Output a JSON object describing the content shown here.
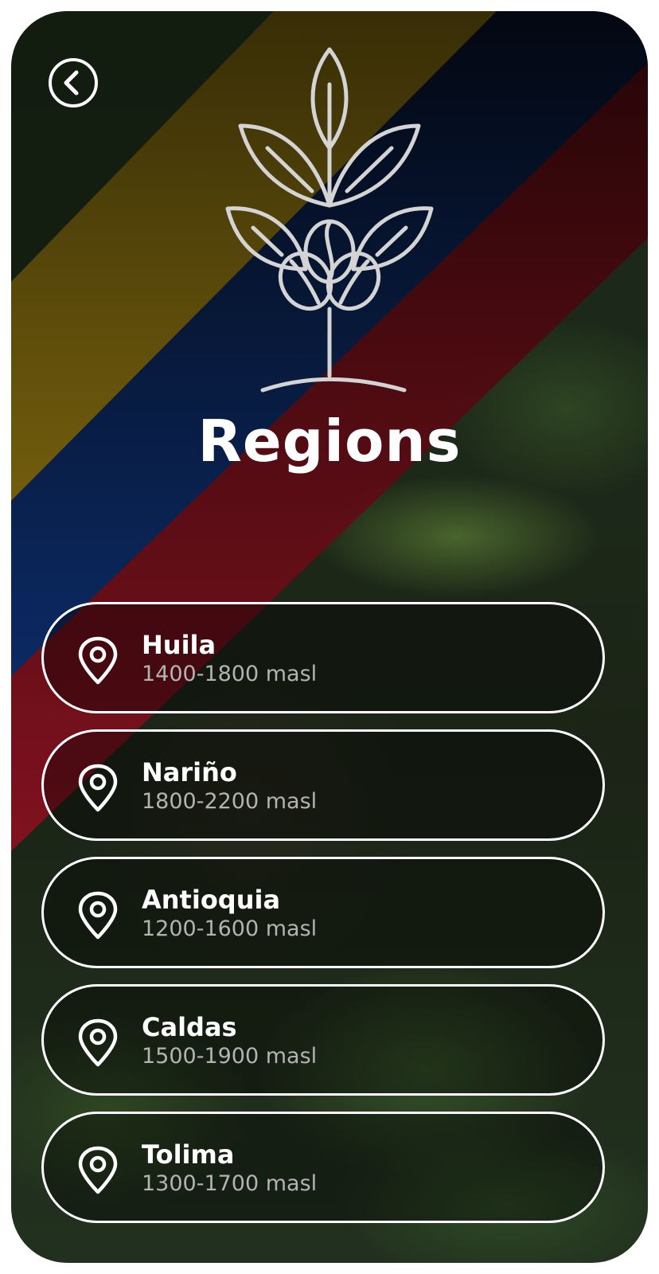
{
  "header": {
    "title": "Regions",
    "back_icon": "chevron-left-icon",
    "logo_icon": "coffee-plant-icon"
  },
  "flag_colors": {
    "yellow": "#5a4708",
    "blue": "#06173d",
    "red": "#4a0810"
  },
  "regions": [
    {
      "name": "Huila",
      "altitude": "1400-1800 masl",
      "icon": "location-pin-icon"
    },
    {
      "name": "Nariño",
      "altitude": "1800-2200 masl",
      "icon": "location-pin-icon"
    },
    {
      "name": "Antioquia",
      "altitude": "1200-1600 masl",
      "icon": "location-pin-icon"
    },
    {
      "name": "Caldas",
      "altitude": "1500-1900 masl",
      "icon": "location-pin-icon"
    },
    {
      "name": "Tolima",
      "altitude": "1300-1700 masl",
      "icon": "location-pin-icon"
    }
  ]
}
